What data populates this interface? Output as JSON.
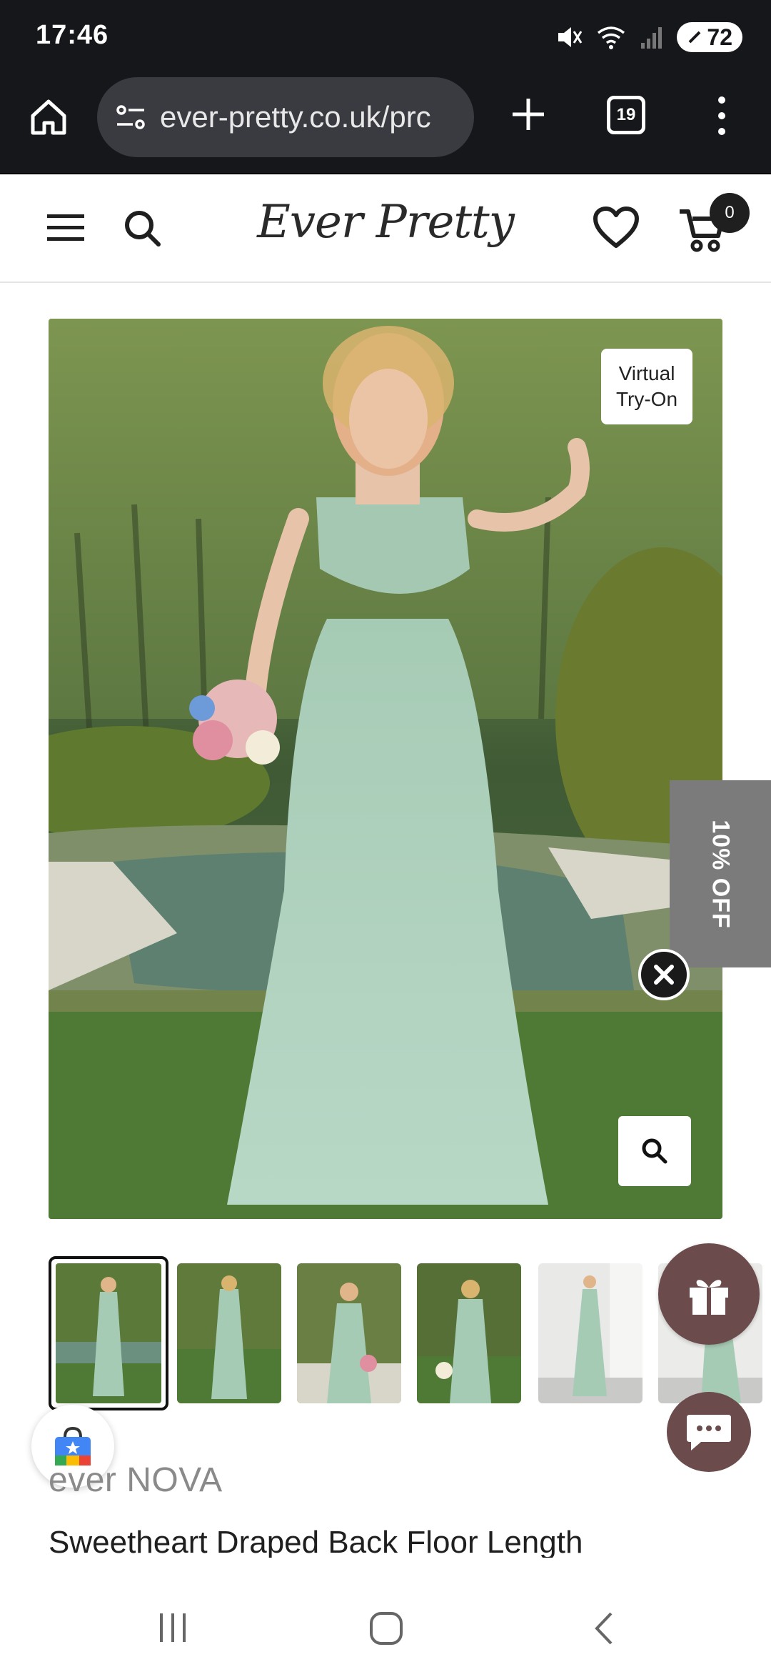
{
  "status_bar": {
    "time": "17:46",
    "battery": "72"
  },
  "browser": {
    "url": "ever-pretty.co.uk/prc",
    "tab_count": "19"
  },
  "site_header": {
    "logo": "Ever Pretty",
    "cart_count": "0"
  },
  "product": {
    "virtual_try_on_line1": "Virtual",
    "virtual_try_on_line2": "Try-On",
    "discount_tab": "10% OFF",
    "brand": "ever NOVA",
    "title": "Sweetheart Draped Back Floor Length Bridesmaid Dress"
  },
  "colors": {
    "dress_sage": "#a6cbb5",
    "accent_brown": "#6b4b4b",
    "status_bg": "#16171b"
  }
}
